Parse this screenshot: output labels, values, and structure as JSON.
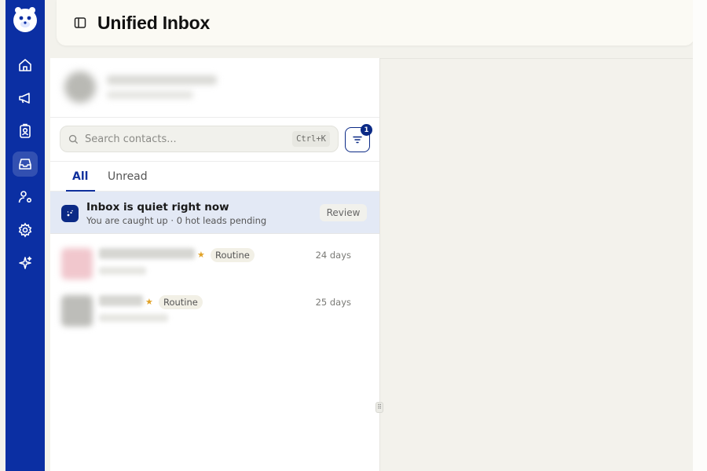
{
  "header": {
    "title": "Unified Inbox"
  },
  "sidebar": {
    "items": [
      {
        "icon": "home-icon"
      },
      {
        "icon": "megaphone-icon"
      },
      {
        "icon": "contact-card-icon"
      },
      {
        "icon": "inbox-icon",
        "active": true
      },
      {
        "icon": "user-settings-icon"
      },
      {
        "icon": "gear-icon"
      },
      {
        "icon": "sparkles-icon"
      }
    ]
  },
  "search": {
    "placeholder": "Search contacts...",
    "shortcut": "Ctrl+K"
  },
  "filter": {
    "badge": "1"
  },
  "tabs": [
    {
      "label": "All",
      "active": true
    },
    {
      "label": "Unread"
    }
  ],
  "notice": {
    "title": "Inbox is quiet right now",
    "subtitle": "You are caught up · 0 hot leads pending",
    "action": "Review"
  },
  "conversations": [
    {
      "tag": "Routine",
      "time": "24 days"
    },
    {
      "tag": "Routine",
      "time": "25 days"
    }
  ],
  "colors": {
    "rail": "#0b2fa3",
    "accent": "#10309c",
    "star": "#e1a227"
  }
}
